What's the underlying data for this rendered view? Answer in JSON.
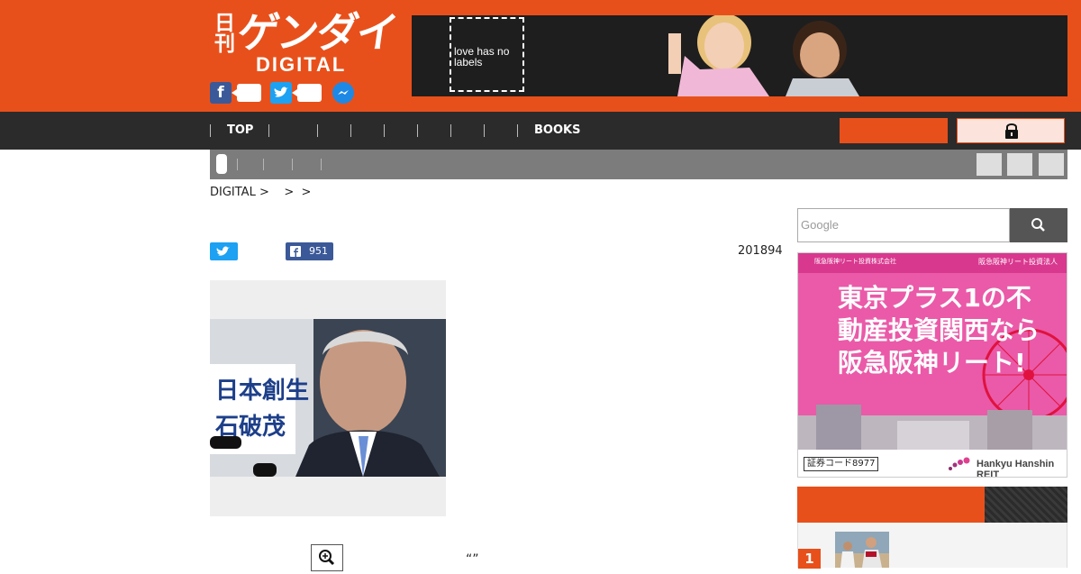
{
  "brand": {
    "logo_kanji": "日刊",
    "logo_katakana": "ゲンダイ",
    "logo_digital": "DIGITAL",
    "accent_color": "#e8501b"
  },
  "header_social": [
    {
      "name": "facebook",
      "icon": "facebook-icon",
      "glyph": "f",
      "color": "#3b5998"
    },
    {
      "name": "twitter",
      "icon": "twitter-icon",
      "glyph": "t",
      "color": "#1da1f2"
    },
    {
      "name": "messenger",
      "icon": "messenger-icon",
      "color": "#1e88e5"
    }
  ],
  "banner_ad": {
    "text": "love has no labels"
  },
  "nav": {
    "items": [
      "TOP",
      "",
      "",
      "",
      "",
      "",
      "",
      "",
      "BOOKS"
    ],
    "lock_icon": "lock-icon"
  },
  "subnav": {
    "items": [
      "",
      "",
      "",
      ""
    ],
    "right_buttons": 3
  },
  "breadcrumb": {
    "text": "DIGITAL >    >  >"
  },
  "share": {
    "twitter_icon": "twitter-icon",
    "facebook_icon": "facebook-icon",
    "facebook_count": "951"
  },
  "article": {
    "date": "201894",
    "quote_text": "“”",
    "zoom_icon": "zoom-icon"
  },
  "photo": {
    "placard_text": "日本創生 石破茂"
  },
  "search": {
    "placeholder": "Google",
    "icon": "search-icon"
  },
  "side_ad": {
    "top_left": "阪急阪神リート投資株式会社",
    "top_right": "阪急阪神リート投資法人",
    "headline": "東京プラス1の不動産投資関西なら阪急阪神リート!",
    "code": "証券コード8977",
    "brand": "Hankyu Hanshin REIT"
  },
  "ranking": {
    "first_number": "1"
  }
}
